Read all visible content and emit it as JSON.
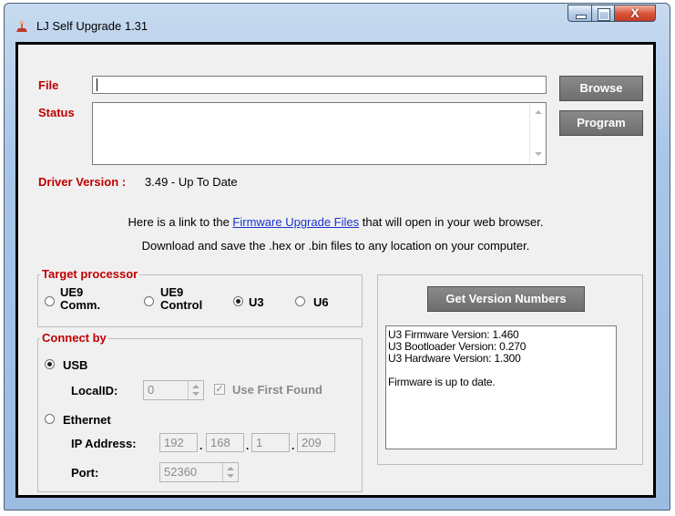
{
  "window": {
    "title": "LJ Self Upgrade 1.31",
    "close_glyph": "X"
  },
  "form": {
    "file_label": "File",
    "file_value": "",
    "status_label": "Status",
    "status_value": "",
    "browse_label": "Browse",
    "program_label": "Program",
    "driver_label": "Driver Version :",
    "driver_value": "3.49 - Up To Date",
    "link_line_before": "Here is a link to the ",
    "link_text": "Firmware Upgrade Files",
    "link_line_after": " that will open in your web browser.",
    "download_line": "Download and save the .hex or .bin files to any location on your computer."
  },
  "target_processor": {
    "label": "Target processor",
    "options": [
      {
        "line1": "UE9",
        "line2": "Comm.",
        "selected": false
      },
      {
        "line1": "UE9",
        "line2": "Control",
        "selected": false
      },
      {
        "line1": "U3",
        "line2": "",
        "selected": true
      },
      {
        "line1": "U6",
        "line2": "",
        "selected": false
      }
    ]
  },
  "connect_by": {
    "label": "Connect by",
    "usb_label": "USB",
    "usb_selected": true,
    "localid_label": "LocalID:",
    "localid_value": "0",
    "use_first_found_label": "Use First Found",
    "use_first_found_checked": true,
    "ethernet_label": "Ethernet",
    "ethernet_selected": false,
    "ip_label": "IP Address:",
    "ip_octets": [
      "192",
      "168",
      "1",
      "209"
    ],
    "ip_sep": ".",
    "port_label": "Port:",
    "port_value": "52360"
  },
  "version_panel": {
    "button_label": "Get Version Numbers",
    "lines": [
      "U3 Firmware Version: 1.460",
      "U3 Bootloader Version: 0.270",
      "U3 Hardware Version: 1.300",
      "",
      "Firmware is up to date."
    ]
  },
  "colors": {
    "label_red": "#c00000",
    "link_blue": "#1a33cc",
    "button_gray": "#7a7a7a"
  }
}
